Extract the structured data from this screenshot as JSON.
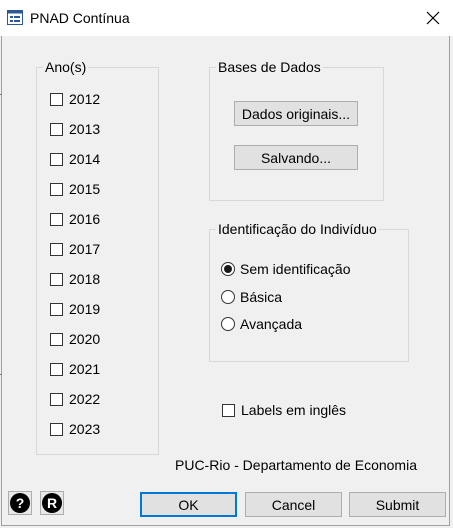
{
  "window": {
    "title": "PNAD Contínua",
    "icon": "form-window-icon",
    "close_icon": "close-icon"
  },
  "years": {
    "legend": "Ano(s)",
    "items": [
      "2012",
      "2013",
      "2014",
      "2015",
      "2016",
      "2017",
      "2018",
      "2019",
      "2020",
      "2021",
      "2022",
      "2023"
    ],
    "checked": [
      false,
      false,
      false,
      false,
      false,
      false,
      false,
      false,
      false,
      false,
      false,
      false
    ]
  },
  "bases": {
    "legend": "Bases de Dados",
    "original_label": "Dados originais...",
    "save_label": "Salvando..."
  },
  "identification": {
    "legend": "Identificação do Indivíduo",
    "options": [
      "Sem identificação",
      "Básica",
      "Avançada"
    ],
    "selected_index": 0
  },
  "labels_english": {
    "label": "Labels em inglês",
    "checked": false
  },
  "footer": {
    "credit": "PUC-Rio - Departamento de Economia",
    "help_icon": "?",
    "r_icon": "R",
    "ok_label": "OK",
    "cancel_label": "Cancel",
    "submit_label": "Submit"
  },
  "colors": {
    "default_button_border": "#0078d7",
    "background": "#f0f0f0"
  }
}
